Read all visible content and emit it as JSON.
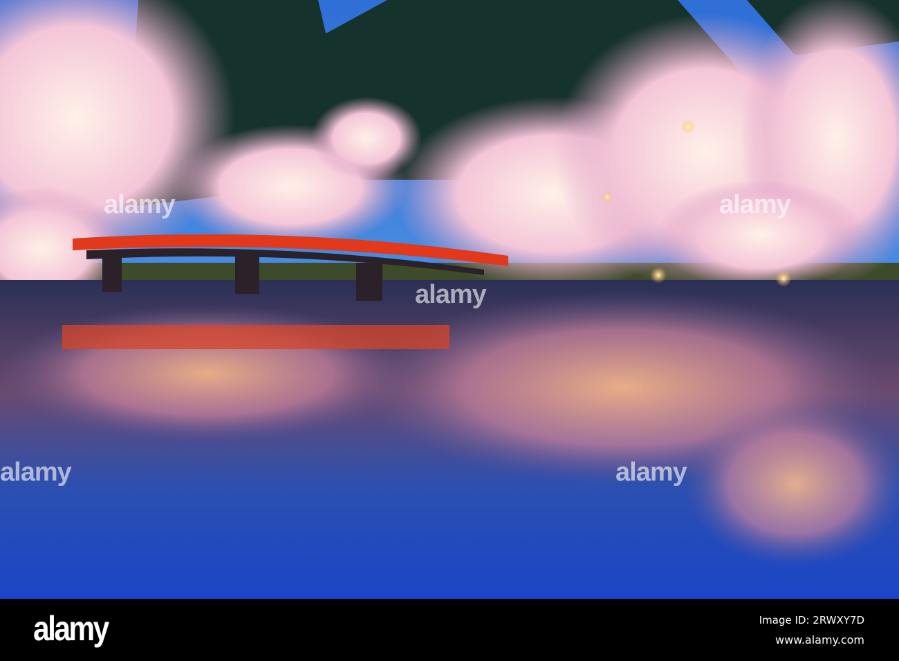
{
  "watermark": {
    "text": "alamy",
    "mark": "a"
  },
  "footer": {
    "logo": "alamy",
    "image_id": "Image ID: 2RWXY7D",
    "website": "www.alamy.com"
  },
  "colors": {
    "sky": "#2f6fd6",
    "bridge": "#e2381c",
    "blossom": "#f3c6d6",
    "water": "#1d4fc4"
  }
}
